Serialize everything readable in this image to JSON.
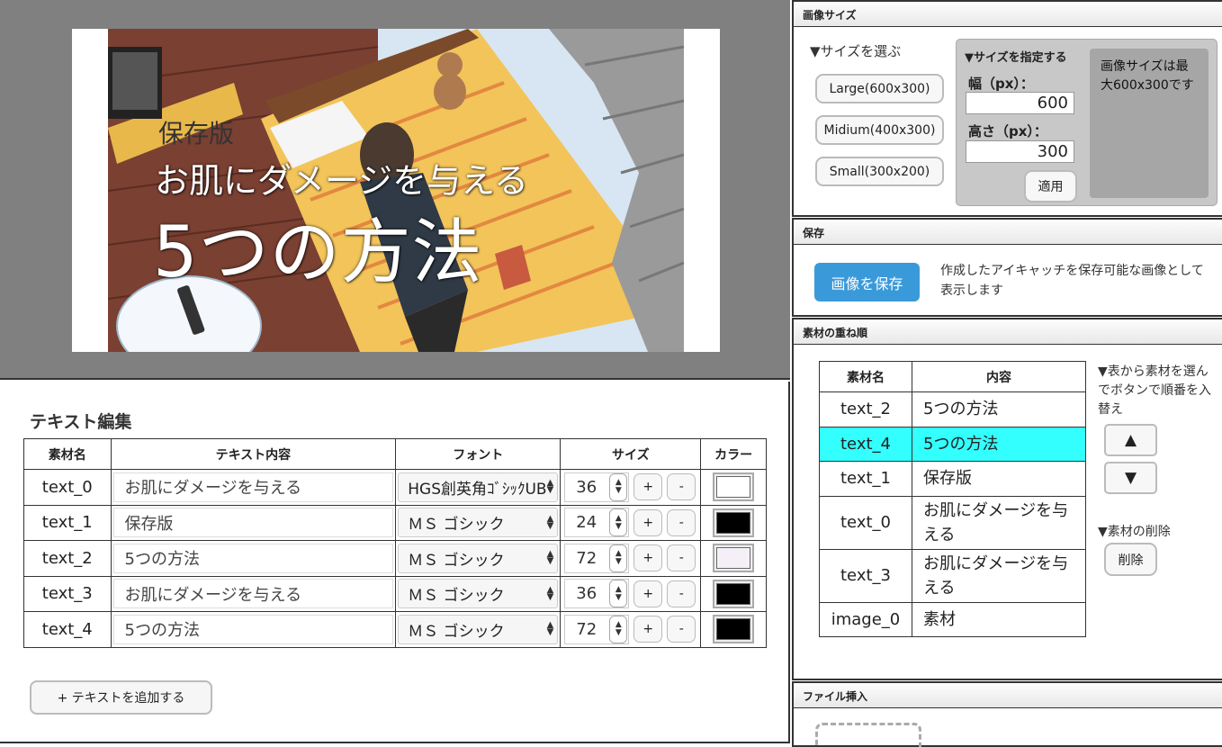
{
  "canvas": {
    "overlay_small": "保存版",
    "overlay_mid": "お肌にダメージを与える",
    "overlay_big": "5つの方法"
  },
  "text_edit": {
    "title": "テキスト編集",
    "headers": [
      "素材名",
      "テキスト内容",
      "フォント",
      "サイズ",
      "カラー"
    ],
    "rows": [
      {
        "name": "text_0",
        "content": "お肌にダメージを与える",
        "font": "HGS創英角ｺﾞｼｯｸUB",
        "size": "36",
        "color": "#ffffff"
      },
      {
        "name": "text_1",
        "content": "保存版",
        "font": "ＭＳ ゴシック",
        "size": "24",
        "color": "#000000"
      },
      {
        "name": "text_2",
        "content": "5つの方法",
        "font": "ＭＳ ゴシック",
        "size": "72",
        "color": "#f5f0f8"
      },
      {
        "name": "text_3",
        "content": "お肌にダメージを与える",
        "font": "ＭＳ ゴシック",
        "size": "36",
        "color": "#000000"
      },
      {
        "name": "text_4",
        "content": "5つの方法",
        "font": "ＭＳ ゴシック",
        "size": "72",
        "color": "#000000"
      }
    ],
    "plus_label": "+",
    "minus_label": "-",
    "add_button": "+ テキストを追加する"
  },
  "size_panel": {
    "header": "画像サイズ",
    "choose_label": "▼サイズを選ぶ",
    "buttons": [
      "Large(600x300)",
      "Midium(400x300)",
      "Small(300x200)"
    ],
    "custom_title": "▼サイズを指定する",
    "width_label": "幅（px）：",
    "width_value": "600",
    "height_label": "高さ（px）：",
    "height_value": "300",
    "apply_button": "適用",
    "note": "画像サイズは最大600x300です"
  },
  "save_panel": {
    "header": "保存",
    "save_button": "画像を保存",
    "description": "作成したアイキャッチを保存可能な画像として表示します"
  },
  "order_panel": {
    "header": "素材の重ね順",
    "headers": [
      "素材名",
      "内容"
    ],
    "rows": [
      {
        "name": "text_2",
        "content": "5つの方法"
      },
      {
        "name": "text_4",
        "content": "5つの方法"
      },
      {
        "name": "text_1",
        "content": "保存版"
      },
      {
        "name": "text_0",
        "content": "お肌にダメージを与える"
      },
      {
        "name": "text_3",
        "content": "お肌にダメージを与える"
      },
      {
        "name": "image_0",
        "content": "素材"
      }
    ],
    "selected_row": "text_4",
    "note": "▼表から素材を選んでボタンで順番を入替え",
    "up_button": "▲",
    "down_button": "▼",
    "delete_note": "▼素材の削除",
    "delete_button": "削除"
  },
  "file_panel": {
    "header": "ファイル挿入"
  },
  "colors": {
    "canvas_bg": "#808080",
    "save_button": "#3a9ad9",
    "selected_row": "#33ffff"
  }
}
